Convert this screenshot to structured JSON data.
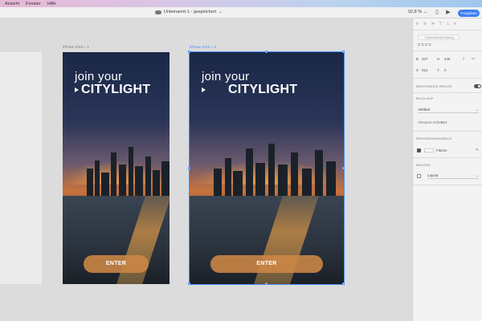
{
  "menubar": {
    "items": [
      "Ansicht",
      "Fenster",
      "Hilfe"
    ]
  },
  "titlebar": {
    "document": "Unbenannt-1 - gespeichert",
    "zoom": "92,8 %",
    "share_label": "Freigeben"
  },
  "canvas": {
    "artboards": [
      {
        "label": "iPhone X/XS – 1",
        "join_text": "join your",
        "brand_text": "CITYLIGHT",
        "button_label": "ENTER"
      },
      {
        "label": "iPhone X/XS – 4",
        "join_text": "join your",
        "brand_text": "CITYLIGHT",
        "button_label": "ENTER"
      }
    ]
  },
  "panel": {
    "repeat_grid_label": "Rasterwiederholung",
    "dimensions": {
      "w_label": "B",
      "w_value": "337",
      "h_label": "H",
      "h_value": "445",
      "x_label": "X",
      "x_value": "812",
      "y_label": "Y",
      "y_value": "0"
    },
    "responsive_label": "RESPONSIVE RESIZE",
    "scroll_heading": "BILDLAUF",
    "scroll_value": "Vertikal",
    "viewport_label": "Viewport-Höhe",
    "viewport_value": "812",
    "appearance_heading": "ERSCHEINUNGSBILD",
    "fill_label": "Fläche",
    "grid_heading": "RASTER",
    "grid_value": "Layout",
    "accent_color": "#3b7df5"
  }
}
